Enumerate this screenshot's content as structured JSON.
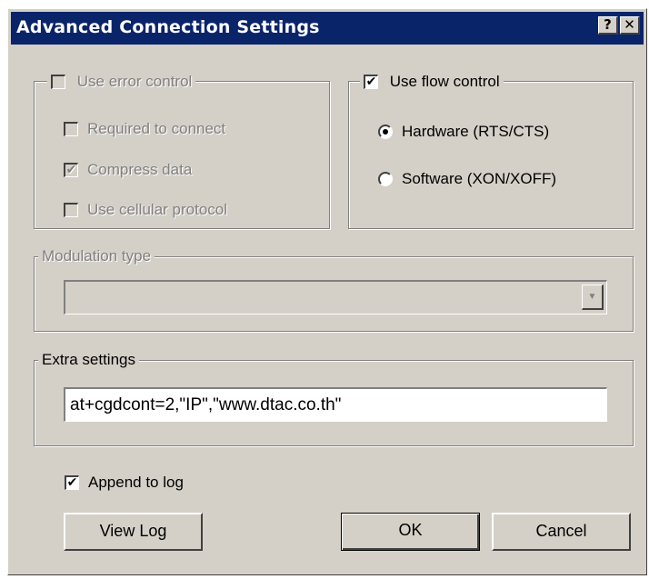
{
  "window": {
    "title": "Advanced Connection Settings",
    "help_label": "?",
    "close_label": "✕"
  },
  "error_control": {
    "label": "Use error control",
    "checked": false,
    "options": {
      "required": {
        "label": "Required to connect",
        "checked": false
      },
      "compress": {
        "label": "Compress data",
        "checked": true
      },
      "cellular": {
        "label": "Use cellular protocol",
        "checked": false
      }
    }
  },
  "flow_control": {
    "label": "Use flow control",
    "checked": true,
    "hardware": {
      "label": "Hardware (RTS/CTS)",
      "selected": true
    },
    "software": {
      "label": "Software (XON/XOFF)",
      "selected": false
    }
  },
  "modulation": {
    "label": "Modulation type",
    "value": ""
  },
  "extra_settings": {
    "label": "Extra settings",
    "value": "at+cgdcont=2,\"IP\",\"www.dtac.co.th\""
  },
  "append_log": {
    "label": "Append to log",
    "checked": true
  },
  "buttons": {
    "view_log": "View Log",
    "ok": "OK",
    "cancel": "Cancel"
  },
  "colors": {
    "titlebar": "#0a246a",
    "face": "#d4d0c8"
  }
}
